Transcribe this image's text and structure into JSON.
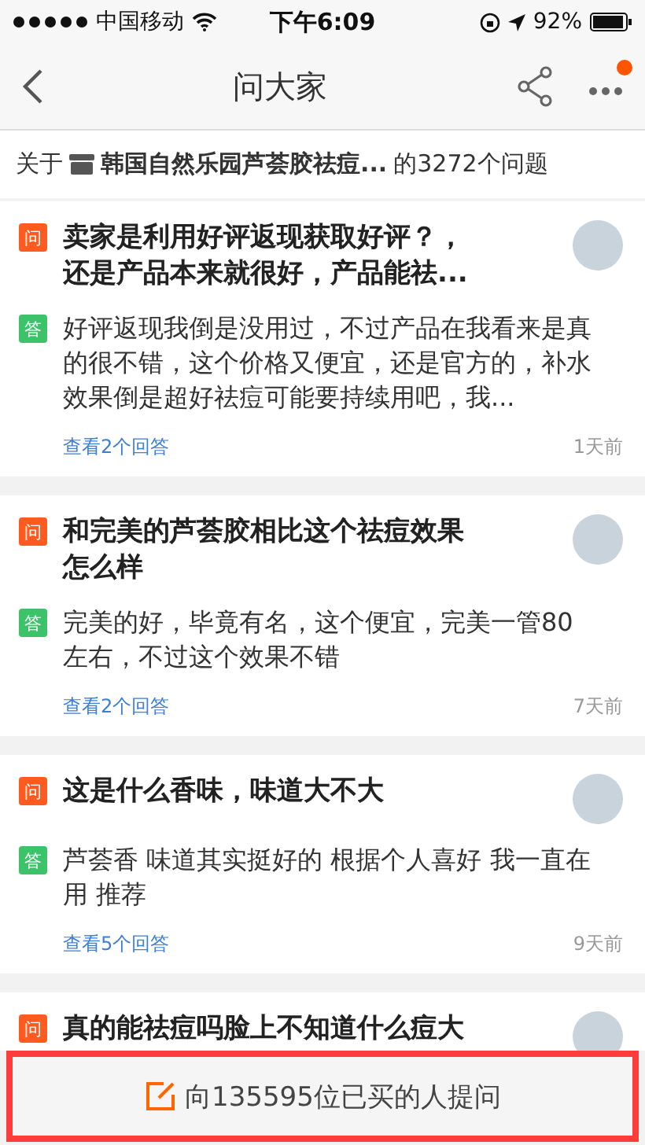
{
  "status_bar": {
    "carrier": "中国移动",
    "time": "下午6:09",
    "battery": "92%"
  },
  "nav": {
    "title": "问大家",
    "notification_dot": true
  },
  "subtitle": {
    "prefix": "关于",
    "product": "韩国自然乐园芦荟胶祛痘...",
    "suffix": "的3272个问题"
  },
  "questions": [
    {
      "badge": "问",
      "question": "卖家是利用好评返现获取好评？，还是产品本来就很好，产品能祛...",
      "answer_badge": "答",
      "answer": "好评返现我倒是没用过，不过产品在我看来是真的很不错，这个价格又便宜，还是官方的，补水效果倒是超好祛痘可能要持续用吧，我...",
      "link": "查看2个回答",
      "time": "1天前"
    },
    {
      "badge": "问",
      "question": "和完美的芦荟胶相比这个祛痘效果怎么样",
      "answer_badge": "答",
      "answer": "完美的好，毕竟有名，这个便宜，完美一管80左右，不过这个效果不错",
      "link": "查看2个回答",
      "time": "7天前"
    },
    {
      "badge": "问",
      "question": "这是什么香味，味道大不大",
      "answer_badge": "答",
      "answer": "芦荟香 味道其实挺好的 根据个人喜好 我一直在用 推荐",
      "link": "查看5个回答",
      "time": "9天前"
    },
    {
      "badge": "问",
      "question": "真的能祛痘吗脸上不知道什么痘大"
    }
  ],
  "ask_button": {
    "label": "向135595位已买的人提问"
  }
}
